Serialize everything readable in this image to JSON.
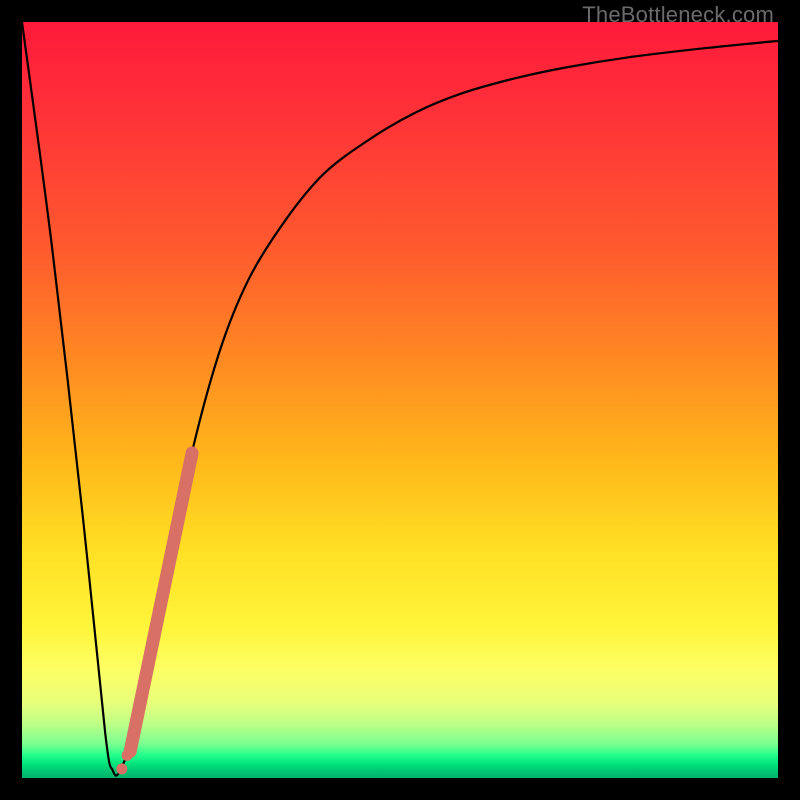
{
  "watermark": "TheBottleneck.com",
  "colors": {
    "curve": "#000000",
    "accent_marker": "#d87065",
    "frame": "#000000"
  },
  "chart_data": {
    "type": "line",
    "title": "",
    "xlabel": "",
    "ylabel": "",
    "xlim": [
      0,
      100
    ],
    "ylim": [
      0,
      100
    ],
    "series": [
      {
        "name": "bottleneck-curve",
        "x": [
          0,
          4,
          8,
          11,
          12,
          13,
          15,
          18,
          22,
          26,
          30,
          35,
          40,
          46,
          52,
          58,
          65,
          72,
          80,
          90,
          100
        ],
        "y": [
          100,
          70,
          35,
          6,
          1,
          1,
          7,
          21,
          41,
          56,
          66,
          74,
          80,
          84.5,
          88,
          90.5,
          92.5,
          94,
          95.3,
          96.5,
          97.5
        ]
      }
    ],
    "accent_segment": {
      "name": "highlighted-range",
      "x": [
        14.3,
        22.5
      ],
      "y": [
        3.5,
        43
      ]
    },
    "accent_dots": [
      {
        "x": 13.2,
        "y": 1.2
      },
      {
        "x": 13.9,
        "y": 3.0
      },
      {
        "x": 14.7,
        "y": 6.0
      }
    ]
  }
}
